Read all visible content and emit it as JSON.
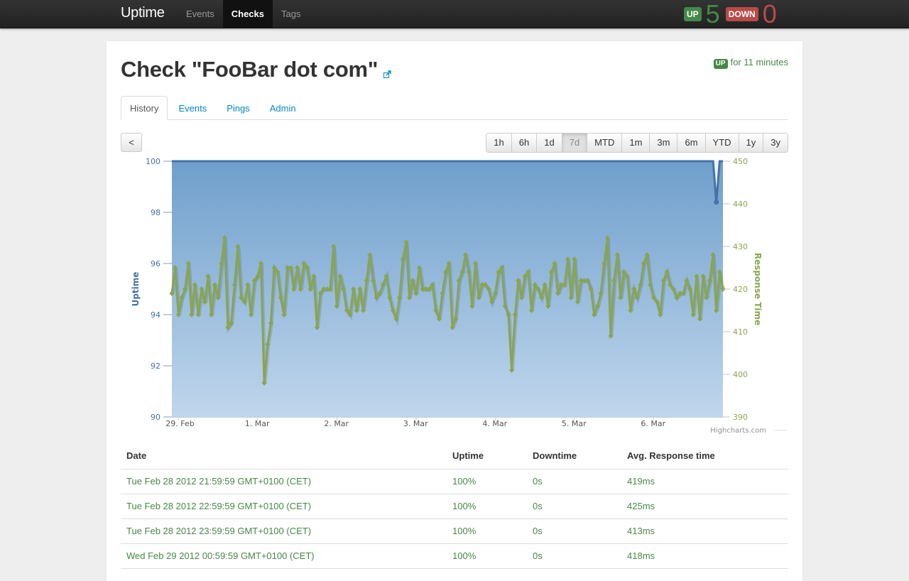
{
  "navbar": {
    "brand": "Uptime",
    "links": [
      {
        "label": "Events",
        "active": false
      },
      {
        "label": "Checks",
        "active": true
      },
      {
        "label": "Tags",
        "active": false
      }
    ],
    "up_label": "UP",
    "up_count": "5",
    "down_label": "DOWN",
    "down_count": "0"
  },
  "check": {
    "title": "Check \"FooBar dot com\"",
    "status_badge": "UP",
    "status_text": "for 11 minutes"
  },
  "tabs": [
    {
      "label": "History",
      "active": true
    },
    {
      "label": "Events",
      "active": false
    },
    {
      "label": "Pings",
      "active": false
    },
    {
      "label": "Admin",
      "active": false
    }
  ],
  "controls": {
    "prev_label": "<",
    "ranges": [
      "1h",
      "6h",
      "1d",
      "7d",
      "MTD",
      "1m",
      "3m",
      "6m",
      "YTD",
      "1y",
      "3y"
    ],
    "active_range": "7d"
  },
  "chart_data": {
    "type": "line",
    "title": "",
    "credits": "Highcharts.com",
    "x_start": "2012-02-28 22:00",
    "x_step_hours": 1,
    "xticks": [
      "29. Feb",
      "1. Mar",
      "2. Mar",
      "3. Mar",
      "4. Mar",
      "5. Mar",
      "6. Mar"
    ],
    "grid": true,
    "legend": "none",
    "y_left": {
      "label": "Uptime",
      "range": [
        90,
        100
      ],
      "ticks": [
        90,
        92,
        94,
        96,
        98,
        100
      ],
      "color": "#4572a7"
    },
    "y_right": {
      "label": "Response Time",
      "range": [
        390,
        450
      ],
      "ticks": [
        390,
        400,
        410,
        420,
        430,
        440,
        450
      ],
      "color": "#89a54e"
    },
    "series": [
      {
        "name": "Uptime",
        "type": "area",
        "axis": "left",
        "color": "#4572a7",
        "values": [
          100,
          100,
          100,
          100,
          100,
          100,
          100,
          100,
          100,
          100,
          100,
          100,
          100,
          100,
          100,
          100,
          100,
          100,
          100,
          100,
          100,
          100,
          100,
          100,
          100,
          100,
          100,
          100,
          100,
          100,
          100,
          100,
          100,
          100,
          100,
          100,
          100,
          100,
          100,
          100,
          100,
          100,
          100,
          100,
          100,
          100,
          100,
          100,
          100,
          100,
          100,
          100,
          100,
          100,
          100,
          100,
          100,
          100,
          100,
          100,
          100,
          100,
          100,
          100,
          100,
          100,
          100,
          100,
          100,
          100,
          100,
          100,
          100,
          100,
          100,
          100,
          100,
          100,
          100,
          100,
          100,
          100,
          100,
          100,
          100,
          100,
          100,
          100,
          100,
          100,
          100,
          100,
          100,
          100,
          100,
          100,
          100,
          100,
          100,
          100,
          100,
          100,
          100,
          100,
          100,
          100,
          100,
          100,
          100,
          100,
          100,
          100,
          100,
          100,
          100,
          100,
          100,
          100,
          100,
          100,
          100,
          100,
          100,
          100,
          100,
          100,
          100,
          100,
          100,
          100,
          100,
          100,
          100,
          100,
          100,
          100,
          100,
          100,
          100,
          100,
          100,
          100,
          100,
          100,
          100,
          100,
          100,
          100,
          100,
          100,
          100,
          100,
          100,
          100,
          100,
          100,
          100,
          100,
          100,
          100,
          100,
          100,
          100,
          100,
          100,
          98.4,
          100,
          100
        ]
      },
      {
        "name": "Response Time",
        "type": "line",
        "axis": "right",
        "color": "#89a54e",
        "values": [
          419,
          425,
          414,
          418,
          420,
          426,
          414,
          421,
          414,
          420,
          417,
          423,
          414,
          421,
          418,
          426,
          432,
          411,
          412,
          421,
          430,
          418,
          417,
          421,
          414,
          422,
          423,
          426,
          398,
          407,
          412,
          425,
          424,
          418,
          414,
          425,
          425,
          420,
          425,
          420,
          426,
          425,
          420,
          423,
          411,
          419,
          420,
          420,
          420,
          430,
          416,
          423,
          420,
          415,
          414,
          420,
          415,
          420,
          415,
          422,
          428,
          422,
          418,
          419,
          421,
          423,
          418,
          415,
          413,
          418,
          427,
          431,
          418,
          422,
          419,
          425,
          420,
          420,
          420,
          421,
          415,
          413,
          419,
          424,
          426,
          411,
          413,
          422,
          424,
          428,
          424,
          416,
          426,
          418,
          421,
          421,
          420,
          417,
          419,
          424,
          425,
          416,
          414,
          401,
          414,
          422,
          418,
          423,
          424,
          415,
          421,
          420,
          418,
          421,
          416,
          424,
          426,
          419,
          421,
          421,
          427,
          418,
          427,
          417,
          422,
          422,
          422,
          420,
          414,
          416,
          419,
          426,
          432,
          409,
          422,
          428,
          418,
          424,
          423,
          415,
          420,
          418,
          421,
          426,
          428,
          421,
          418,
          417,
          414,
          422,
          424,
          421,
          420,
          418,
          419,
          419,
          422,
          420,
          414,
          423,
          413,
          423,
          418,
          422,
          428,
          415,
          424,
          420
        ]
      }
    ]
  },
  "table": {
    "headers": [
      "Date",
      "Uptime",
      "Downtime",
      "Avg. Response time"
    ],
    "rows": [
      [
        "Tue Feb 28 2012 21:59:59 GMT+0100 (CET)",
        "100%",
        "0s",
        "419ms"
      ],
      [
        "Tue Feb 28 2012 22:59:59 GMT+0100 (CET)",
        "100%",
        "0s",
        "425ms"
      ],
      [
        "Tue Feb 28 2012 23:59:59 GMT+0100 (CET)",
        "100%",
        "0s",
        "413ms"
      ],
      [
        "Wed Feb 29 2012 00:59:59 GMT+0100 (CET)",
        "100%",
        "0s",
        "418ms"
      ]
    ]
  }
}
